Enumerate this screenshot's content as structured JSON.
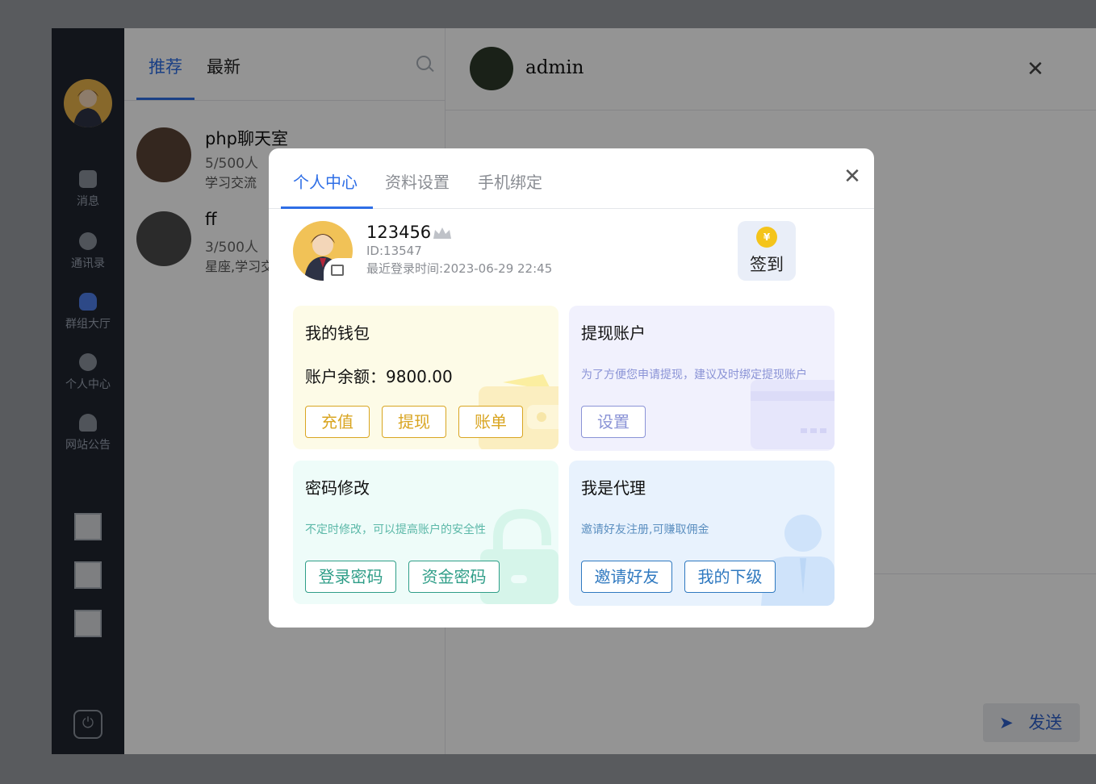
{
  "sidebar": {
    "items": [
      {
        "label": "消息",
        "icon": "message-icon"
      },
      {
        "label": "通讯录",
        "icon": "contacts-icon"
      },
      {
        "label": "群组大厅",
        "icon": "group-hall-icon"
      },
      {
        "label": "个人中心",
        "icon": "profile-icon"
      },
      {
        "label": "网站公告",
        "icon": "announcement-icon"
      }
    ]
  },
  "list": {
    "tabs": [
      "推荐",
      "最新"
    ],
    "rooms": [
      {
        "name": "php聊天室",
        "count": "5/500人",
        "desc": "学习交流"
      },
      {
        "name": "ff",
        "count": "3/500人",
        "desc": "星座,学习交"
      }
    ]
  },
  "chat": {
    "title": "admin",
    "send_label": "发送"
  },
  "modal": {
    "tabs": [
      "个人中心",
      "资料设置",
      "手机绑定"
    ],
    "profile": {
      "username": "123456",
      "id_text": "ID:13547",
      "last_login_label": "最近登录时间:",
      "last_login_time": "2023-06-29 22:45"
    },
    "checkin": {
      "coin": "¥",
      "label": "签到"
    },
    "wallet": {
      "title": "我的钱包",
      "balance_label": "账户余额：",
      "balance": "9800.00",
      "buttons": [
        "充值",
        "提现",
        "账单"
      ]
    },
    "withdraw": {
      "title": "提现账户",
      "desc": "为了方便您申请提现，建议及时绑定提现账户",
      "button": "设置"
    },
    "password": {
      "title": "密码修改",
      "desc": "不定时修改，可以提高账户的安全性",
      "buttons": [
        "登录密码",
        "资金密码"
      ]
    },
    "agent": {
      "title": "我是代理",
      "desc": "邀请好友注册,可赚取佣金",
      "buttons": [
        "邀请好友",
        "我的下级"
      ]
    }
  },
  "colors": {
    "accent": "#2e6ee6",
    "wallet": "#d9a521",
    "withdraw": "#8a93d6",
    "password": "#2f9e88",
    "agent": "#2f79c0"
  }
}
